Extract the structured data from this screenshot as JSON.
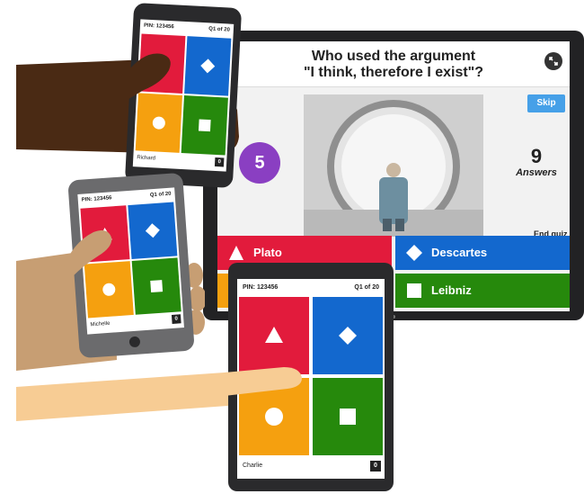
{
  "quiz": {
    "question_line1": "Who used the argument",
    "question_line2": "\"I think, therefore I exist\"?",
    "skip_label": "Skip",
    "timer": "5",
    "answers_count": "9",
    "answers_label": "Answers",
    "end_quiz_label": "End quiz",
    "options": [
      {
        "label": "Plato",
        "color": "#e21b3c",
        "shape": "triangle-icon"
      },
      {
        "label": "Descartes",
        "color": "#1368ce",
        "shape": "diamond-icon"
      },
      {
        "label": "",
        "color": "#f5a00f",
        "shape": "circle-icon"
      },
      {
        "label": "Leibniz",
        "color": "#26890c",
        "shape": "square-icon"
      }
    ]
  },
  "devices": {
    "phone_richard": {
      "pin": "PIN: 123456",
      "question_no": "Q1 of 20",
      "player": "Richard",
      "score": "0"
    },
    "phone_michelle": {
      "pin": "PIN: 123456",
      "question_no": "Q1 of 20",
      "player": "Michelle",
      "score": "0"
    },
    "tablet_charlie": {
      "pin": "PIN: 123456",
      "question_no": "Q1 of 20",
      "player": "Charlie",
      "score": "0"
    }
  },
  "colors": {
    "red": "#e21b3c",
    "blue": "#1368ce",
    "yellow": "#f5a00f",
    "green": "#26890c",
    "purple": "#8a3fc2"
  }
}
